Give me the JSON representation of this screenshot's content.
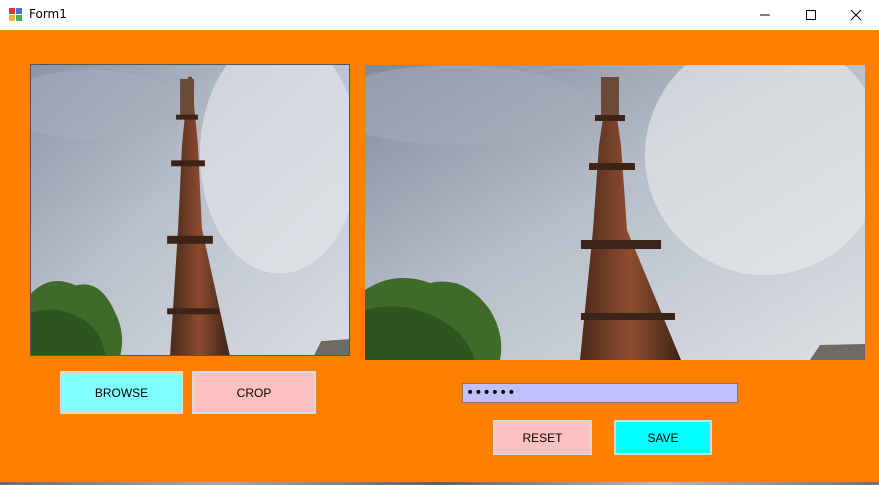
{
  "window": {
    "title": "Form1",
    "icons": {
      "app": "form-app-icon",
      "minimize": "minimize-icon",
      "maximize": "maximize-icon",
      "close": "close-icon"
    }
  },
  "colors": {
    "form_background": "#ff8000",
    "browse_button": "#80ffff",
    "crop_button": "#ffc0c0",
    "reset_button": "#ffc0c0",
    "save_button": "#00ffff",
    "password_field": "#c0c0ff"
  },
  "buttons": {
    "browse": "BROWSE",
    "crop": "CROP",
    "reset": "RESET",
    "save": "SAVE"
  },
  "password": {
    "value": "123456"
  }
}
